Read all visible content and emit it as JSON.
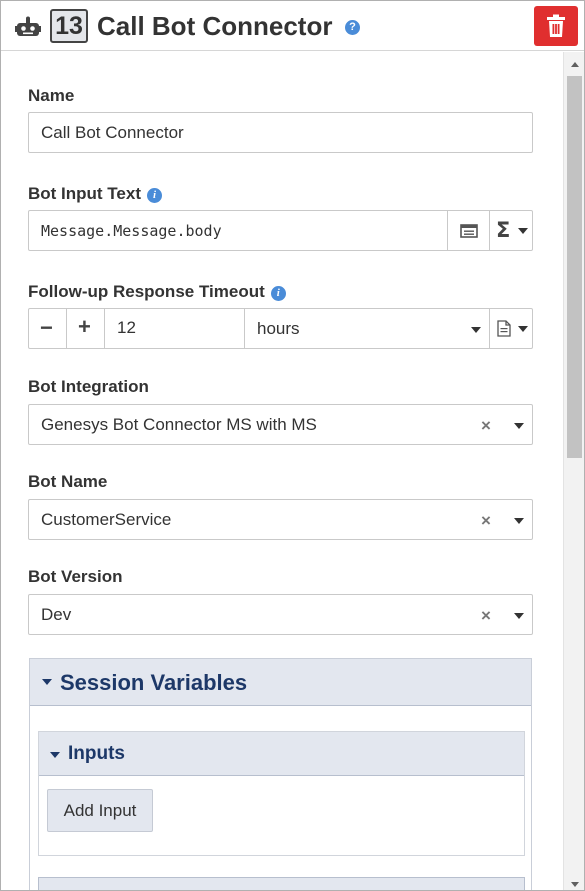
{
  "header": {
    "step_number": "13",
    "title": "Call Bot Connector",
    "help_icon": "question-circle-icon",
    "delete_icon": "trash-icon",
    "delete_color": "#e02f2f",
    "robot_icon": "robot-icon"
  },
  "form": {
    "name": {
      "label": "Name",
      "value": "Call Bot Connector"
    },
    "bot_input_text": {
      "label": "Bot Input Text",
      "value": "Message.Message.body",
      "expression_icon": "expression-editor-icon",
      "sigma_icon": "sigma-icon"
    },
    "followup_timeout": {
      "label": "Follow-up Response Timeout",
      "decrement": "−",
      "increment": "+",
      "value": "12",
      "unit": "hours",
      "doc_icon": "document-icon"
    },
    "bot_integration": {
      "label": "Bot Integration",
      "value": "Genesys Bot Connector MS with MS"
    },
    "bot_name": {
      "label": "Bot Name",
      "value": "CustomerService"
    },
    "bot_version": {
      "label": "Bot Version",
      "value": "Dev"
    },
    "clear_glyph": "×"
  },
  "session_variables": {
    "title": "Session Variables",
    "inputs": {
      "title": "Inputs",
      "add_button": "Add Input"
    }
  },
  "colors": {
    "accent": "#4a8cd8",
    "section_header": "#e3e7ef",
    "section_title": "#1d3868"
  }
}
